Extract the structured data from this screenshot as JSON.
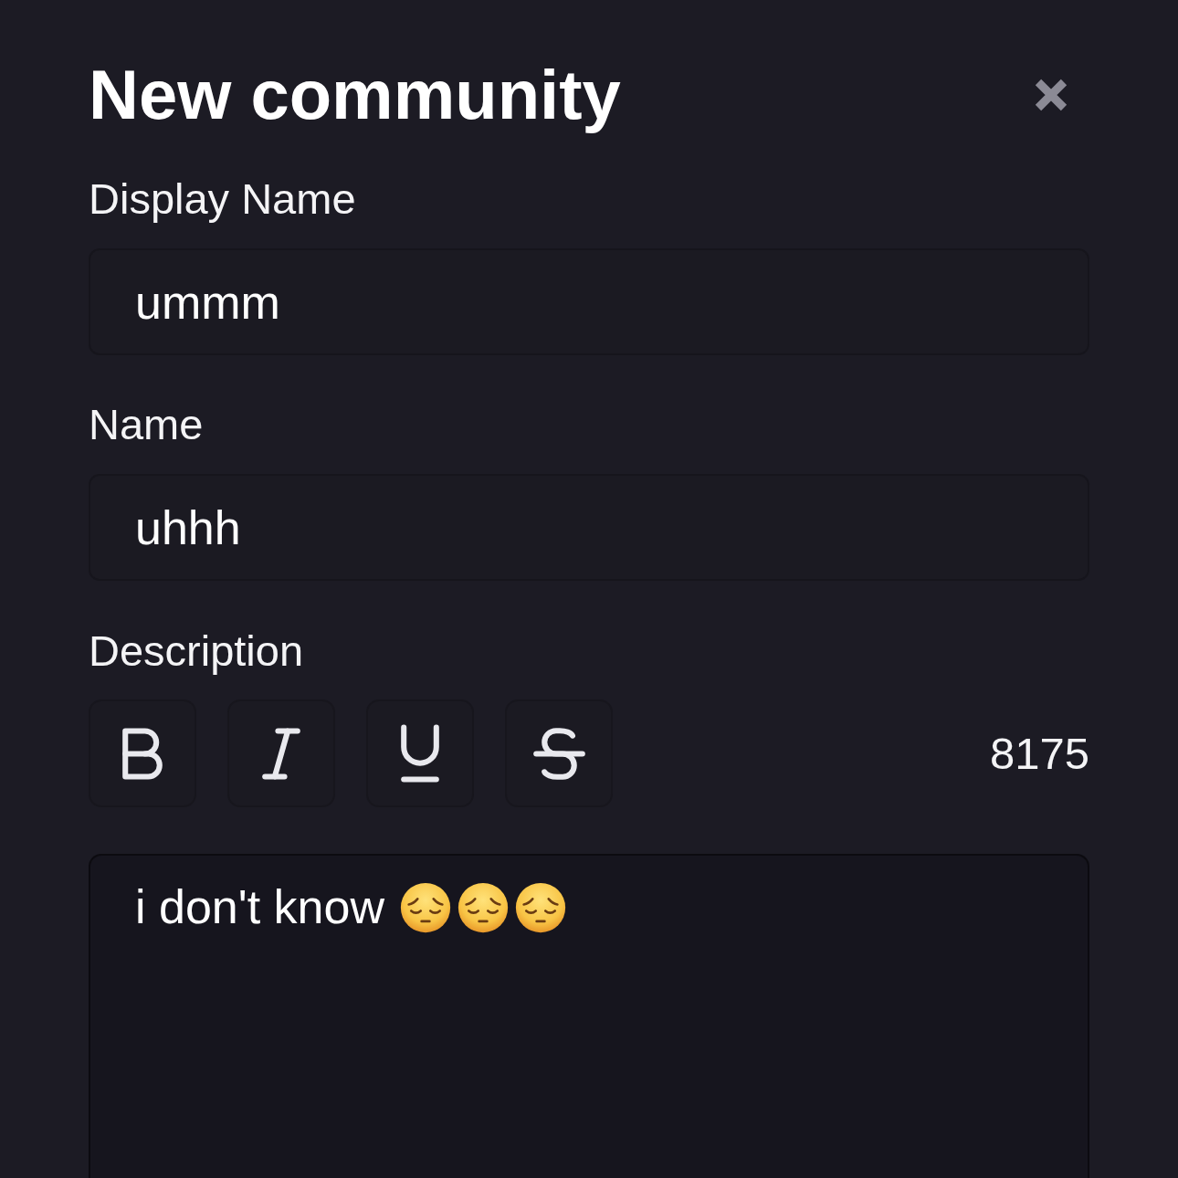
{
  "dialog": {
    "title": "New community"
  },
  "fields": [
    {
      "label": "Display Name",
      "value": "ummm"
    },
    {
      "label": "Name",
      "value": "uhhh"
    }
  ],
  "description": {
    "label": "Description",
    "toolbar": [
      {
        "kind": "bold"
      },
      {
        "kind": "italic"
      },
      {
        "kind": "underline"
      },
      {
        "kind": "strikethrough"
      }
    ],
    "counter": "8175",
    "focused": true,
    "value": "i don't know",
    "emojis": [
      {
        "kind": "pensive"
      },
      {
        "kind": "pensive"
      },
      {
        "kind": "pensive"
      }
    ]
  }
}
